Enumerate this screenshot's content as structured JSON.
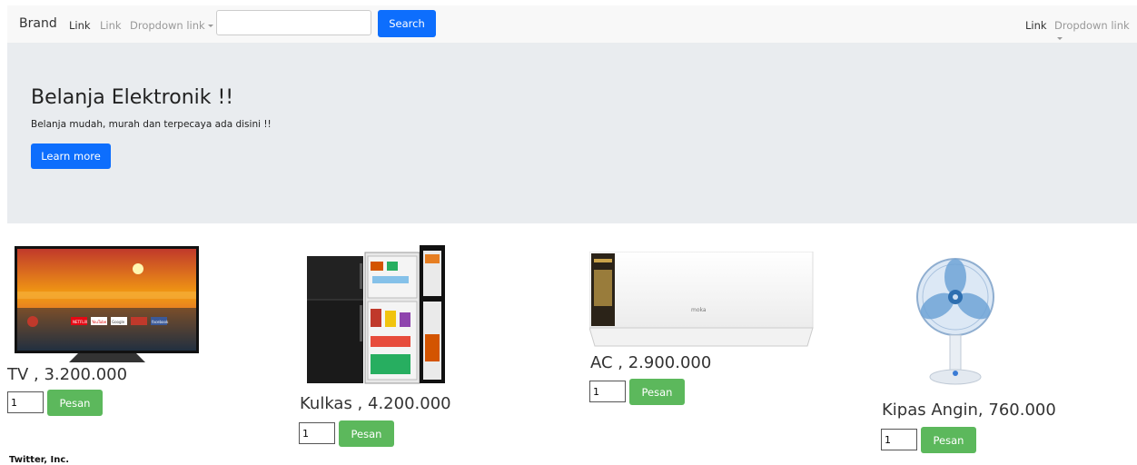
{
  "navbar": {
    "brand": "Brand",
    "left_links": [
      "Link",
      "Link"
    ],
    "dropdown_left": "Dropdown link",
    "search_placeholder": "",
    "search_value": "",
    "search_button": "Search",
    "right_link": "Link",
    "dropdown_right": "Dropdown link"
  },
  "jumbotron": {
    "title": "Belanja Elektronik !!",
    "text": "Belanja mudah, murah dan terpecaya ada disini !!",
    "button": "Learn more"
  },
  "products": [
    {
      "name": "TV , 3.200.000",
      "quantity": "1",
      "button": "Pesan",
      "icon": "tv-image"
    },
    {
      "name": "Kulkas , 4.200.000",
      "quantity": "1",
      "button": "Pesan",
      "icon": "refrigerator-image"
    },
    {
      "name": "AC , 2.900.000",
      "quantity": "1",
      "button": "Pesan",
      "icon": "air-conditioner-image"
    },
    {
      "name": "Kipas Angin, 760.000",
      "quantity": "1",
      "button": "Pesan",
      "icon": "fan-image"
    }
  ],
  "tv_screen_apps": [
    "NETFLIX",
    "YouTube",
    "Google",
    "facebook"
  ],
  "ac_brand": "moka",
  "footer": "Twitter, Inc.",
  "colors": {
    "primary": "#0d6efd",
    "success": "#5cb85c",
    "jumbotron_bg": "#e9ecef",
    "navbar_bg": "#f8f8f8"
  }
}
